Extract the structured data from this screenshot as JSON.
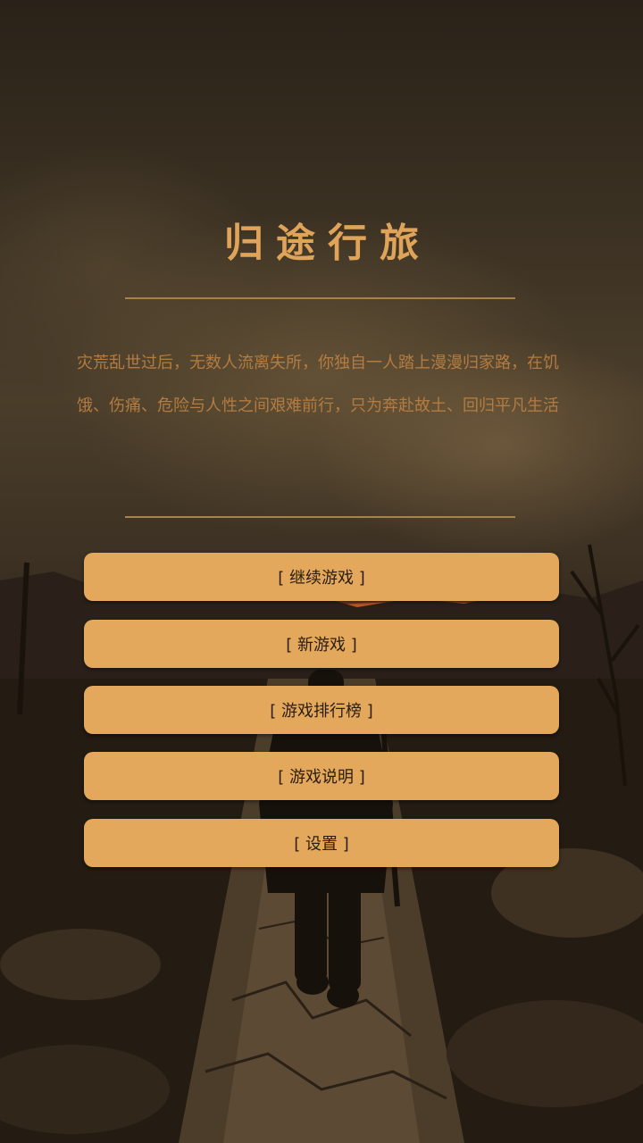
{
  "game": {
    "title": "归途行旅",
    "description_lines": [
      "灾荒乱世过后，无数人流离失所，你独自一人踏上漫漫归家路，在饥",
      "饿、伤痛、危险与人性之间艰难前行，只为奔赴故土、回归平凡生活"
    ]
  },
  "menu": {
    "items": [
      {
        "label": "[ 继续游戏 ]"
      },
      {
        "label": "[ 新游戏 ]"
      },
      {
        "label": "[ 游戏排行榜 ]"
      },
      {
        "label": "[ 游戏说明 ]"
      },
      {
        "label": "[ 设置 ]"
      }
    ]
  },
  "colors": {
    "accent": "#e3a85b",
    "title": "#e0a35a",
    "description": "#b47c40",
    "button_text": "#2b1d0e",
    "divider": "#a8824d"
  }
}
